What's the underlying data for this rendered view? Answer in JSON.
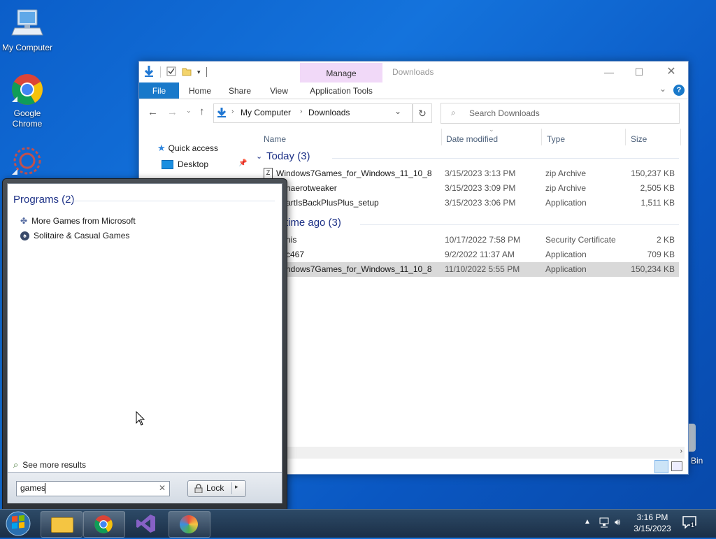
{
  "desktop": {
    "icons": [
      {
        "label": "My Computer"
      },
      {
        "label": "Google Chrome"
      },
      {
        "label": ""
      }
    ],
    "recycle_bin_label": "Bin"
  },
  "explorer": {
    "title": "Downloads",
    "manage_tab": "Manage",
    "ribbon_tabs": [
      "File",
      "Home",
      "Share",
      "View",
      "Application Tools"
    ],
    "breadcrumb": [
      "My Computer",
      "Downloads"
    ],
    "search_placeholder": "Search Downloads",
    "nav": {
      "quick_access": "Quick access",
      "desktop": "Desktop"
    },
    "columns": [
      "Name",
      "Date modified",
      "Type",
      "Size"
    ],
    "groups": [
      {
        "label": "Today (3)",
        "files": [
          {
            "name": "Windows7Games_for_Windows_11_10_8",
            "date": "3/15/2023 3:13 PM",
            "type": "zip Archive",
            "size": "150,237 KB"
          },
          {
            "name": "haerotweaker",
            "date": "3/15/2023 3:09 PM",
            "type": "zip Archive",
            "size": "2,505 KB"
          },
          {
            "name": "artIsBackPlusPlus_setup",
            "date": "3/15/2023 3:06 PM",
            "type": "Application",
            "size": "1,511 KB"
          }
        ]
      },
      {
        "label": "ng time ago (3)",
        "files": [
          {
            "name": "nis",
            "date": "10/17/2022 7:58 PM",
            "type": "Security Certificate",
            "size": "2 KB"
          },
          {
            "name": "c467",
            "date": "9/2/2022 11:37 AM",
            "type": "Application",
            "size": "709 KB"
          },
          {
            "name": "ndows7Games_for_Windows_11_10_8",
            "date": "11/10/2022 5:55 PM",
            "type": "Application",
            "size": "150,234 KB",
            "selected": true
          }
        ]
      }
    ]
  },
  "start_menu": {
    "section": "Programs (2)",
    "programs": [
      "More Games from Microsoft",
      "Solitaire & Casual Games"
    ],
    "see_more": "See more results",
    "search_value": "games",
    "lock_label": "Lock"
  },
  "taskbar": {
    "time": "3:16 PM",
    "date": "3/15/2023",
    "notification_count": "1"
  }
}
